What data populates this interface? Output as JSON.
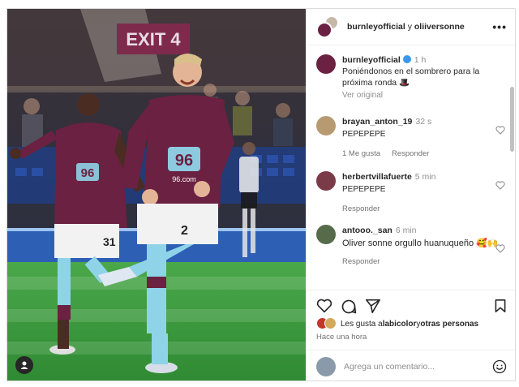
{
  "photo": {
    "stadium_sign": "EXIT 4",
    "sponsor": "96",
    "sponsor_sub": "96.com",
    "number_left": "31",
    "number_right": "2",
    "alt_icon": "user-tag-icon"
  },
  "header": {
    "user1": "burnleyofficial",
    "conj": "y",
    "user2": "oliiversonne",
    "more_label": "•••"
  },
  "caption": {
    "username": "burnleyofficial",
    "time": "1 h",
    "text": "Poniéndonos en el sombrero para la próxima ronda 🎩",
    "see_original": "Ver original"
  },
  "comments": [
    {
      "username": "brayan_anton_19",
      "time": "32 s",
      "text": "PEPEPEPE",
      "likes": "1 Me gusta",
      "reply": "Responder"
    },
    {
      "username": "herbertvillafuerte",
      "time": "5 min",
      "text": "PEPEPEPE",
      "reply": "Responder"
    },
    {
      "username": "antooo._san",
      "time": "6 min",
      "text": "Oliver sonne orgullo huanuqueño 🥰🙌",
      "reply": "Responder"
    }
  ],
  "likes": {
    "prefix": "Les gusta a ",
    "user": "labicolor",
    "suffix": " y ",
    "others": "otras personas"
  },
  "posted": "Hace una hora",
  "add_comment": {
    "placeholder": "Agrega un comentario..."
  },
  "colors": {
    "claret": "#6b2141",
    "sky": "#8fd3e8",
    "pitch": "#3a9a3d",
    "verified": "#3897f0"
  }
}
